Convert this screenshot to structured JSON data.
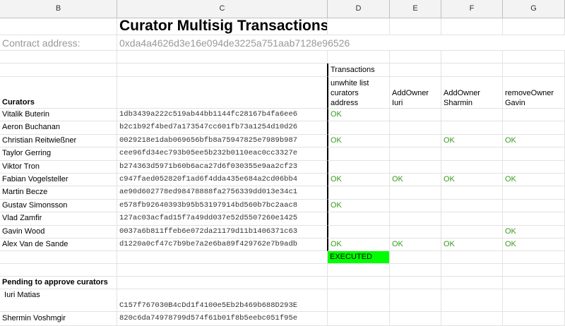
{
  "columns": [
    "B",
    "C",
    "D",
    "E",
    "F",
    "G"
  ],
  "title": "Curator Multisig Transactions",
  "contract_label": "Contract address:",
  "contract_address": "0xda4a4626d3e16e094de3225a751aab7128e96526",
  "transactions_header": "Transactions",
  "tx_headers": [
    "unwhite list curators address",
    "AddOwner Iuri",
    "AddOwner Sharmin",
    "removeOwner Gavin"
  ],
  "curators_header": "Curators",
  "curators": [
    {
      "name": "Vitalik Buterin",
      "addr": "1db3439a222c519ab44bb1144fc28167b4fa6ee6",
      "d": "OK",
      "e": "",
      "f": "",
      "g": ""
    },
    {
      "name": "Aeron Buchanan",
      "addr": "b2c1b92f4bed7a173547cc601fb73a1254d10d26",
      "d": "",
      "e": "",
      "f": "",
      "g": ""
    },
    {
      "name": "Christian Reitwießner",
      "addr": "0029218e1dab069656bfb8a75947825e7989b987",
      "d": "OK",
      "e": "",
      "f": "OK",
      "g": "OK"
    },
    {
      "name": "Taylor Gerring",
      "addr": "cee96fd34ec793b05ee5b232b0110eac0cc3327e",
      "d": "",
      "e": "",
      "f": "",
      "g": ""
    },
    {
      "name": "Viktor Tron",
      "addr": "b274363d5971b60b6aca27d6f030355e9aa2cf23",
      "d": "",
      "e": "",
      "f": "",
      "g": ""
    },
    {
      "name": "Fabian Vogelsteller",
      "addr": "c947faed052820f1ad6f4dda435e684a2cd06bb4",
      "d": "OK",
      "e": "OK",
      "f": "OK",
      "g": "OK"
    },
    {
      "name": "Martin Becze",
      "addr": "ae90d602778ed98478888fa2756339dd013e34c1",
      "d": "",
      "e": "",
      "f": "",
      "g": ""
    },
    {
      "name": "Gustav Simonsson",
      "addr": "e578fb92640393b95b53197914bd560b7bc2aac8",
      "d": "OK",
      "e": "",
      "f": "",
      "g": ""
    },
    {
      "name": "Vlad Zamfir",
      "addr": "127ac03acfad15f7a49dd037e52d5507260e1425",
      "d": "",
      "e": "",
      "f": "",
      "g": ""
    },
    {
      "name": "Gavin Wood",
      "addr": "0037a6b811ffeb6e072da21179d11b1406371c63",
      "d": "",
      "e": "",
      "f": "",
      "g": "OK"
    },
    {
      "name": "Alex Van de Sande",
      "addr": "d1220a0cf47c7b9be7a2e6ba89f429762e7b9adb",
      "d": "OK",
      "e": "OK",
      "f": "OK",
      "g": "OK"
    }
  ],
  "executed_label": "EXECUTED",
  "pending_header": "Pending to approve curators",
  "pending": [
    {
      "name": " Iuri Matias",
      "addr": "C157f767030B4cDd1f4100e5Eb2b469b688D293E"
    },
    {
      "name": "Shermin Voshmgir",
      "addr": "820c6da74978799d574f61b01f8b5eebc051f95e"
    }
  ]
}
